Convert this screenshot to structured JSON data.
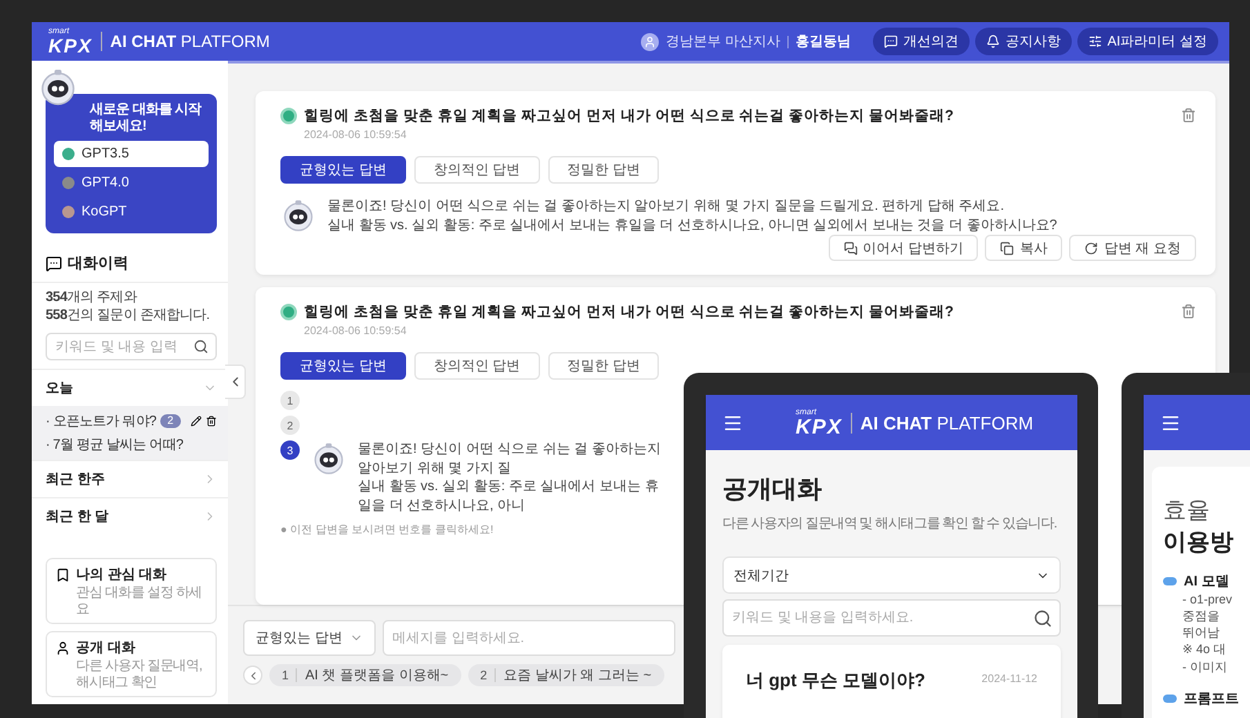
{
  "header": {
    "logo_small": "smart",
    "logo": "KPX",
    "title_bold": "AI CHAT",
    "title_light": "PLATFORM",
    "user_org": "경남본부 마산지사",
    "user_name": "홍길동님",
    "buttons": [
      {
        "label": "개선의견",
        "kind": "chat"
      },
      {
        "label": "공지사항",
        "kind": "bell"
      },
      {
        "label": "AI파라미터 설정",
        "kind": "sliders"
      }
    ]
  },
  "sidebar": {
    "new_chat": {
      "title": "새로운 대화를 시작해보세요!",
      "models": [
        {
          "label": "GPT3.5",
          "selected": true,
          "color": "#3bae8c"
        },
        {
          "label": "GPT4.0",
          "selected": false,
          "color": "#8a8a8a"
        },
        {
          "label": "KoGPT",
          "selected": false,
          "color": "#b89790"
        }
      ]
    },
    "history": {
      "title": "대화이력",
      "summary": [
        "**354**개의 주제와",
        "**558**건의 질문이 존재합니다."
      ],
      "search_placeholder": "키워드 및 내용 입력",
      "groups": [
        {
          "label": "오늘",
          "expanded": true,
          "items": [
            {
              "text": "· 오픈노트가 뭐야?",
              "badge": "2",
              "hovered": true
            },
            {
              "text": "· 7월 평균 날씨는 어때?",
              "hovered": false
            }
          ]
        },
        {
          "label": "최근 한주",
          "expanded": false
        },
        {
          "label": "최근 한 달",
          "expanded": false
        }
      ]
    },
    "shortcuts": [
      {
        "title": "나의 관심 대화",
        "subtitle": "관심 대화를 설정 하세요",
        "kind": "bookmark"
      },
      {
        "title": "공개 대화",
        "subtitle": "다른 사용자 질문내역, 해시태그 확인",
        "kind": "user"
      }
    ]
  },
  "conversations": [
    {
      "kind": "full",
      "question": "힐링에 초첨을 맞춘 휴일 계획을 짜고싶어 먼저 내가 어떤 식으로 쉬는걸 좋아하는지 물어봐줄래?",
      "date": "2024-08-06 10:59:54",
      "styles": [
        {
          "label": "균형있는 답변",
          "selected": true
        },
        {
          "label": "창의적인 답변",
          "selected": false
        },
        {
          "label": "정밀한 답변",
          "selected": false
        }
      ],
      "answer_lines": [
        "물론이죠! 당신이 어떤 식으로 쉬는 걸 좋아하는지 알아보기 위해 몇 가지 질문을 드릴게요. 편하게 답해 주세요.",
        "실내 활동 vs. 실외 활동: 주로 실내에서 보내는 휴일을 더 선호하시나요, 아니면 실외에서 보내는 것을 더 좋아하시나요?"
      ],
      "actions": [
        {
          "label": "이어서 답변하기",
          "kind": "chat"
        },
        {
          "label": "복사",
          "kind": "copy"
        },
        {
          "label": "답변 재 요청",
          "kind": "retry"
        }
      ]
    },
    {
      "kind": "versions",
      "question": "힐링에 초첨을 맞춘 휴일 계획을 짜고싶어 먼저 내가 어떤 식으로 쉬는걸 좋아하는지 물어봐줄래?",
      "date": "2024-08-06 10:59:54",
      "styles": [
        {
          "label": "균형있는 답변",
          "selected": true
        },
        {
          "label": "창의적인 답변",
          "selected": false
        },
        {
          "label": "정밀한 답변",
          "selected": false
        }
      ],
      "versions": [
        {
          "label": "1",
          "selected": false
        },
        {
          "label": "2",
          "selected": false
        },
        {
          "label": "3",
          "selected": true
        }
      ],
      "answer_lines": [
        "물론이죠! 당신이 어떤 식으로 쉬는 걸 좋아하는지 알아보기 위해 몇 가지 질",
        "실내 활동 vs. 실외 활동: 주로 실내에서 보내는 휴일을 더 선호하시나요, 아니"
      ],
      "note": "● 이전 답변을 보시려면 번호를 클릭하세요!"
    }
  ],
  "composer": {
    "style_select": "균형있는 답변",
    "placeholder": "메세지를 입력하세요.",
    "recent": [
      {
        "number": "1",
        "text": "AI 챗 플랫폼을 이용해~"
      },
      {
        "number": "2",
        "text": "요즘 날씨가 왜 그러는 ~"
      }
    ]
  },
  "mobile_public": {
    "logo_small": "smart",
    "logo": "KPX",
    "title_bold": "AI CHAT",
    "title_light": "PLATFORM",
    "title": "공개대화",
    "subtitle": "다른 사용자의 질문내역 및 해시태그를 확인 할 수 있습니다.",
    "period_select": "전체기간",
    "search_placeholder": "키워드 및 내용을 입력하세요.",
    "card": {
      "title": "너 gpt 무슨 모델이야?",
      "date": "2024-11-12"
    }
  },
  "mobile_guide": {
    "title_light": "효율",
    "title_bold": "이용방",
    "sections": [
      {
        "heading": "AI 모델",
        "lines": [
          "- o1-prev",
          "중점을",
          "뛰어남",
          "※ 4o 대",
          "- 이미지"
        ]
      },
      {
        "heading": "프롬프트"
      }
    ]
  }
}
